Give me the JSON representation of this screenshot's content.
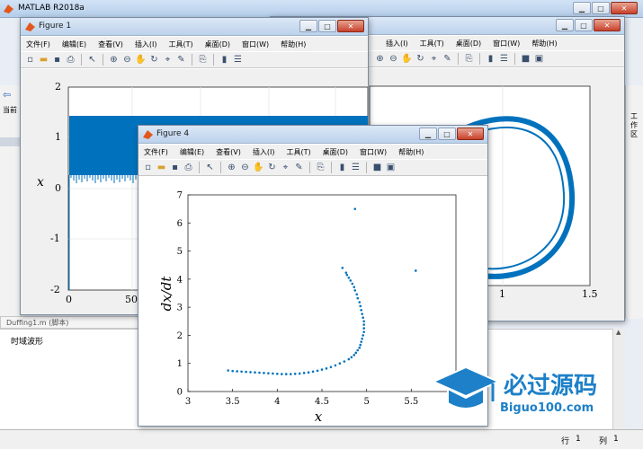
{
  "matlab": {
    "title": "MATLAB R2018a",
    "left_label": "当前",
    "right_label": "工作区",
    "script_tab": "Duffing1.m (脚本)",
    "command_text": "时域波形",
    "status_line_label": "行",
    "status_line_value": "1",
    "status_col_label": "列",
    "status_col_value": "1"
  },
  "figure1": {
    "title": "Figure 1",
    "menu": [
      "文件(F)",
      "编辑(E)",
      "查看(V)",
      "插入(I)",
      "工具(T)",
      "桌面(D)",
      "窗口(W)",
      "帮助(H)"
    ],
    "yticks": [
      "2",
      "1",
      "0",
      "-1",
      "-2"
    ],
    "xticks": [
      "0",
      "50"
    ],
    "ylabel": "x"
  },
  "figure2": {
    "menu": [
      "插入(I)",
      "工具(T)",
      "桌面(D)",
      "窗口(W)",
      "帮助(H)"
    ],
    "xticks": [
      "1",
      "1.5"
    ]
  },
  "figure4": {
    "title": "Figure 4",
    "menu": [
      "文件(F)",
      "编辑(E)",
      "查看(V)",
      "插入(I)",
      "工具(T)",
      "桌面(D)",
      "窗口(W)",
      "帮助(H)"
    ]
  },
  "watermark": {
    "brand": "必过源码",
    "url": "Biguo100.com"
  },
  "chart_data": [
    {
      "type": "scatter",
      "xlabel": "x",
      "ylabel": "dx/dt",
      "xlim": [
        3,
        6
      ],
      "ylim": [
        0,
        7
      ],
      "xticks": [
        3,
        3.5,
        4,
        4.5,
        5,
        5.5,
        6
      ],
      "yticks": [
        0,
        1,
        2,
        3,
        4,
        5,
        6,
        7
      ],
      "grid": false,
      "color": "#0072bd",
      "points": [
        [
          3.45,
          0.75
        ],
        [
          3.5,
          0.73
        ],
        [
          3.55,
          0.72
        ],
        [
          3.6,
          0.71
        ],
        [
          3.65,
          0.7
        ],
        [
          3.7,
          0.69
        ],
        [
          3.75,
          0.68
        ],
        [
          3.8,
          0.67
        ],
        [
          3.85,
          0.66
        ],
        [
          3.9,
          0.65
        ],
        [
          3.95,
          0.64
        ],
        [
          4.0,
          0.63
        ],
        [
          4.05,
          0.62
        ],
        [
          4.1,
          0.62
        ],
        [
          4.15,
          0.62
        ],
        [
          4.2,
          0.63
        ],
        [
          4.25,
          0.64
        ],
        [
          4.3,
          0.66
        ],
        [
          4.35,
          0.68
        ],
        [
          4.4,
          0.71
        ],
        [
          4.45,
          0.74
        ],
        [
          4.5,
          0.78
        ],
        [
          4.55,
          0.82
        ],
        [
          4.6,
          0.87
        ],
        [
          4.65,
          0.93
        ],
        [
          4.7,
          1.0
        ],
        [
          4.75,
          1.07
        ],
        [
          4.8,
          1.15
        ],
        [
          4.83,
          1.22
        ],
        [
          4.86,
          1.3
        ],
        [
          4.88,
          1.38
        ],
        [
          4.9,
          1.47
        ],
        [
          4.92,
          1.56
        ],
        [
          4.93,
          1.66
        ],
        [
          4.94,
          1.77
        ],
        [
          4.95,
          1.88
        ],
        [
          4.96,
          2.0
        ],
        [
          4.97,
          2.12
        ],
        [
          4.97,
          2.25
        ],
        [
          4.97,
          2.38
        ],
        [
          4.97,
          2.5
        ],
        [
          4.96,
          2.63
        ],
        [
          4.95,
          2.76
        ],
        [
          4.94,
          2.9
        ],
        [
          4.93,
          3.04
        ],
        [
          4.92,
          3.18
        ],
        [
          4.9,
          3.32
        ],
        [
          4.89,
          3.46
        ],
        [
          4.87,
          3.6
        ],
        [
          4.86,
          3.72
        ],
        [
          4.84,
          3.84
        ],
        [
          4.82,
          3.95
        ],
        [
          4.8,
          4.05
        ],
        [
          4.78,
          4.15
        ],
        [
          4.77,
          4.23
        ],
        [
          4.87,
          6.5
        ],
        [
          5.55,
          4.3
        ],
        [
          4.73,
          4.4
        ]
      ]
    },
    {
      "type": "line",
      "ylabel": "x",
      "xlim": [
        0,
        100
      ],
      "ylim": [
        -2,
        2
      ],
      "description_values": {
        "upper_band": 1.3,
        "lower_band": 0.05
      }
    }
  ]
}
